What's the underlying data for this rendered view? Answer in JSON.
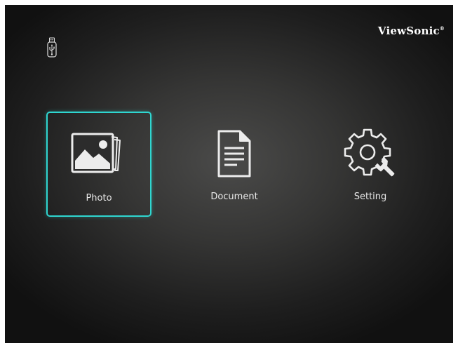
{
  "brand": {
    "logo_text": "ViewSonic",
    "trademark": "®"
  },
  "storage": {
    "source_icon": "usb-drive-icon"
  },
  "menu": {
    "selected": "photo",
    "accent_color": "#2fd6d0",
    "items": [
      {
        "id": "photo",
        "label": "Photo",
        "icon": "photo-gallery-icon"
      },
      {
        "id": "document",
        "label": "Document",
        "icon": "document-icon"
      },
      {
        "id": "setting",
        "label": "Setting",
        "icon": "gear-wrench-icon"
      }
    ]
  }
}
